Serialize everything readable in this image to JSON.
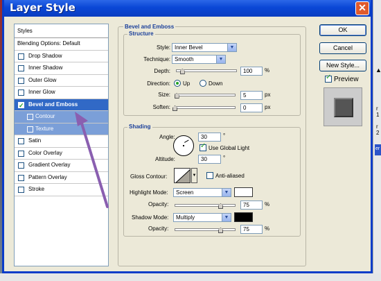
{
  "window": {
    "title": "Layer Style",
    "close_glyph": "✕"
  },
  "styles_panel": {
    "heading": "Styles",
    "blending": "Blending Options: Default",
    "items": [
      {
        "label": "Drop Shadow",
        "checked": false
      },
      {
        "label": "Inner Shadow",
        "checked": false
      },
      {
        "label": "Outer Glow",
        "checked": false
      },
      {
        "label": "Inner Glow",
        "checked": false
      },
      {
        "label": "Bevel and Emboss",
        "checked": true,
        "selected": true
      },
      {
        "label": "Contour",
        "checked": false,
        "sub": true
      },
      {
        "label": "Texture",
        "checked": false,
        "sub": true
      },
      {
        "label": "Satin",
        "checked": false
      },
      {
        "label": "Color Overlay",
        "checked": false
      },
      {
        "label": "Gradient Overlay",
        "checked": false
      },
      {
        "label": "Pattern Overlay",
        "checked": false
      },
      {
        "label": "Stroke",
        "checked": false
      }
    ]
  },
  "bevel": {
    "group_title": "Bevel and Emboss",
    "structure_title": "Structure",
    "style_label": "Style:",
    "style_value": "Inner Bevel",
    "technique_label": "Technique:",
    "technique_value": "Smooth",
    "depth_label": "Depth:",
    "depth_value": "100",
    "depth_unit": "%",
    "depth_level": 0.1,
    "direction_label": "Direction:",
    "direction_up": "Up",
    "direction_down": "Down",
    "direction_selected": "Up",
    "size_label": "Size:",
    "size_value": "5",
    "size_unit": "px",
    "size_level": 0.03,
    "soften_label": "Soften:",
    "soften_value": "0",
    "soften_unit": "px",
    "soften_level": 0.0
  },
  "shading": {
    "title": "Shading",
    "angle_label": "Angle:",
    "angle_value": "30",
    "angle_suffix": "°",
    "global_light_label": "Use Global Light",
    "global_light_checked": true,
    "altitude_label": "Altitude:",
    "altitude_value": "30",
    "altitude_suffix": "°",
    "gloss_label": "Gloss Contour:",
    "anti_aliased_label": "Anti-aliased",
    "anti_aliased_checked": false,
    "highlight_label": "Highlight Mode:",
    "highlight_mode": "Screen",
    "highlight_color": "#ffffff",
    "highlight_opacity_label": "Opacity:",
    "highlight_opacity": "75",
    "highlight_opacity_level": 0.75,
    "shadow_label": "Shadow Mode:",
    "shadow_mode": "Multiply",
    "shadow_color": "#000000",
    "shadow_opacity_label": "Opacity:",
    "shadow_opacity": "75",
    "shadow_opacity_level": 0.75,
    "percent": "%"
  },
  "buttons": {
    "ok": "OK",
    "cancel": "Cancel",
    "new_style": "New Style..."
  },
  "preview": {
    "label": "Preview",
    "checked": true
  },
  "background": {
    "frag1": "r 1",
    "frag2": "r 2",
    "frag3": "er",
    "frag4": "▲"
  },
  "colors": {
    "title_bar": "#0a47d6",
    "selected_row": "#3169c6",
    "sub_row": "#7b9fd8",
    "group_title": "#1a3f9a",
    "arrow": "#8a5fb0"
  }
}
